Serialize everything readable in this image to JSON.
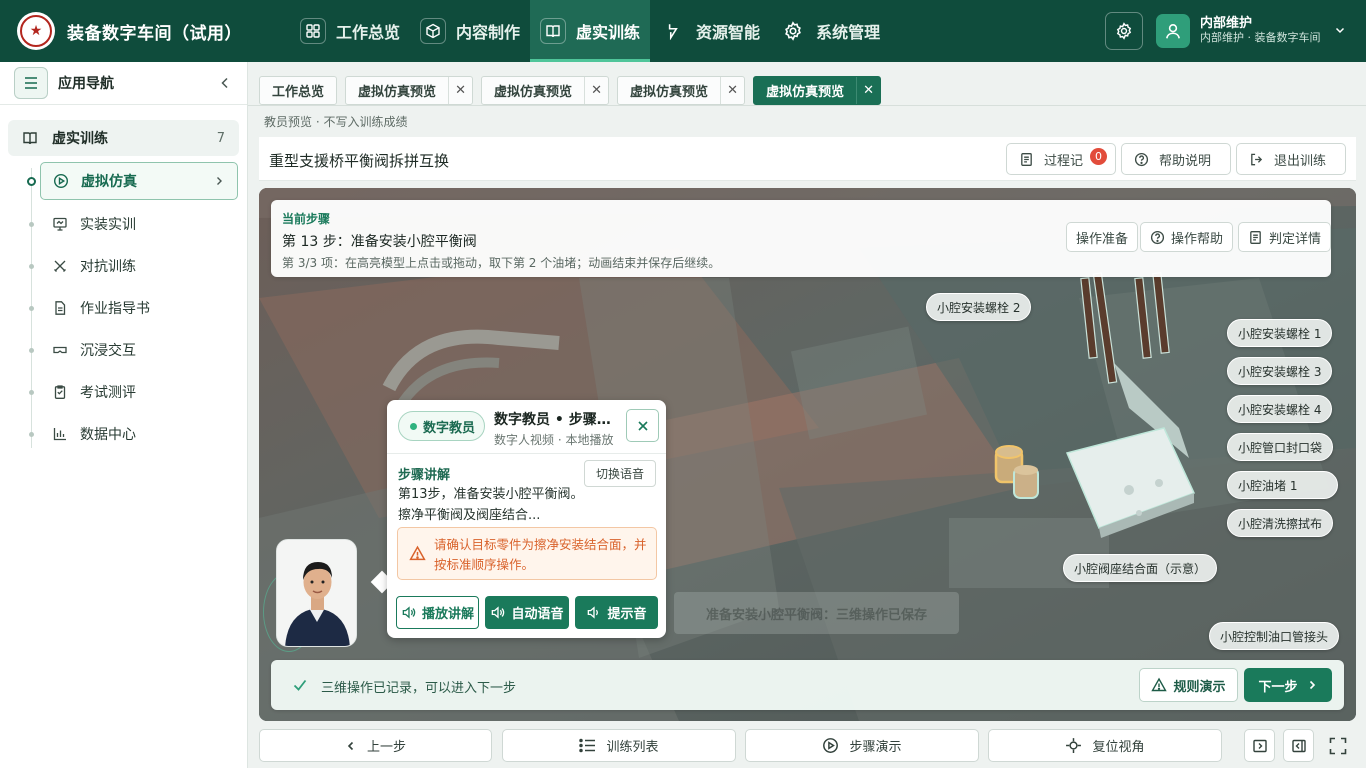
{
  "app": {
    "title": "装备数字车间（试用）",
    "logo_glyph": "★"
  },
  "topnav": [
    {
      "label": "工作总览",
      "icon": "grid-icon",
      "active": false
    },
    {
      "label": "内容制作",
      "icon": "cube-icon",
      "active": false
    },
    {
      "label": "虚实训练",
      "icon": "book-icon",
      "active": true
    },
    {
      "label": "资源智能",
      "icon": "lightning-icon",
      "active": false
    },
    {
      "label": "系统管理",
      "icon": "gear-icon",
      "active": false
    }
  ],
  "user": {
    "name": "内部维护",
    "subtitle": "内部维护 · 装备数字车间"
  },
  "sidebar": {
    "title": "应用导航",
    "group": {
      "label": "虚实训练",
      "count": "7"
    },
    "items": [
      {
        "label": "虚拟仿真",
        "icon": "play-circle-icon",
        "active": true
      },
      {
        "label": "实装实训",
        "icon": "monitor-icon",
        "active": false
      },
      {
        "label": "对抗训练",
        "icon": "swords-icon",
        "active": false
      },
      {
        "label": "作业指导书",
        "icon": "document-icon",
        "active": false
      },
      {
        "label": "沉浸交互",
        "icon": "vr-headset-icon",
        "active": false
      },
      {
        "label": "考试测评",
        "icon": "clipboard-icon",
        "active": false
      },
      {
        "label": "数据中心",
        "icon": "bar-chart-icon",
        "active": false
      }
    ]
  },
  "tabs": [
    {
      "label": "工作总览",
      "closable": false,
      "active": false
    },
    {
      "label": "虚拟仿真预览",
      "closable": true,
      "active": false
    },
    {
      "label": "虚拟仿真预览",
      "closable": true,
      "active": false
    },
    {
      "label": "虚拟仿真预览",
      "closable": true,
      "active": false
    },
    {
      "label": "虚拟仿真预览",
      "closable": true,
      "active": true
    }
  ],
  "tab_close_glyph": "✕",
  "hint": "教员预览 · 不写入训练成绩",
  "header": {
    "title": "重型支援桥平衡阀拆拼互换",
    "process_label": "过程记",
    "process_badge": "0",
    "help_label": "帮助说明",
    "exit_label": "退出训练"
  },
  "step": {
    "kicker": "当前步骤",
    "title": "第 13 步：准备安装小腔平衡阀",
    "desc": "第 3/3 项：在高亮模型上点击或拖动，取下第 2 个油堵；动画结束并保存后继续。",
    "buttons": {
      "prepare": "操作准备",
      "help": "操作帮助",
      "judge": "判定详情"
    }
  },
  "part_labels": {
    "bolt2": "小腔安装螺栓 2",
    "bolt1": "小腔安装螺栓 1",
    "bolt3": "小腔安装螺栓 3",
    "bolt4": "小腔安装螺栓 4",
    "seal_bag": "小腔管口封口袋",
    "plug1": "小腔油堵 1",
    "cloth": "小腔清洗擦拭布",
    "seat": "小腔阀座结合面（示意）",
    "connector": "小腔控制油口管接头"
  },
  "ghost_text": "准备安装小腔平衡阀：三维操作已保存",
  "status": {
    "text": "三维操作已记录，可以进入下一步",
    "rule_label": "规则演示",
    "next_label": "下一步"
  },
  "teacher": {
    "tag": "数字教员",
    "title": "数字教员 • 步骤讲解",
    "subtitle": "数字人视频 · 本地播放",
    "section": "步骤讲解",
    "switch_label": "切换语音",
    "body": "第13步，准备安装小腔平衡阀。擦净平衡阀及阀座结合...",
    "warning": "请确认目标零件为擦净安装结合面，并按标准顺序操作。",
    "buttons": {
      "play": "播放讲解",
      "auto": "自动语音",
      "tone": "提示音"
    }
  },
  "bottom": {
    "prev": "上一步",
    "list": "训练列表",
    "demo": "步骤演示",
    "reset": "复位视角"
  },
  "colors": {
    "brand": "#0f4c3c",
    "accent": "#1a7a5b",
    "warning": "#d9622b",
    "badge": "#e24c3b"
  }
}
